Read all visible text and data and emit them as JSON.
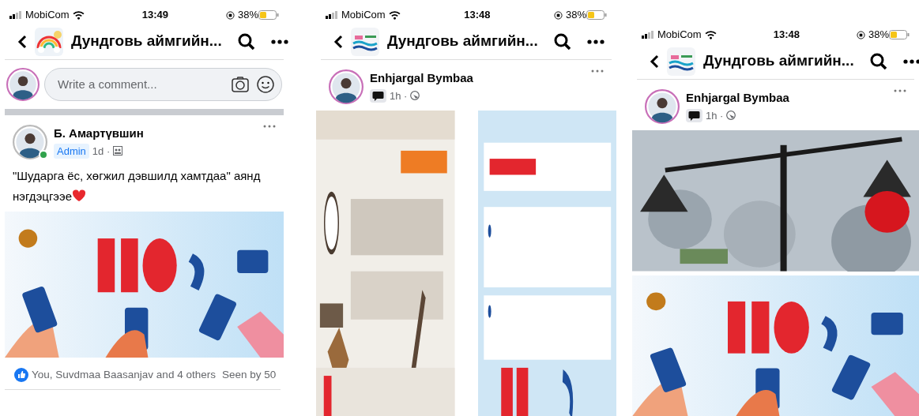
{
  "phones": [
    {
      "status_bar": {
        "carrier": "MobiCom",
        "time": "13:49",
        "battery": "38%"
      },
      "header": {
        "title": "Дундговь аймгийн..."
      },
      "composer": {
        "placeholder": "Write a comment..."
      },
      "post": {
        "author": "Б. Амартүвшин",
        "online": true,
        "role_badge": "Admin",
        "chat_badge": false,
        "time": "1d ·",
        "text": "\"Шударга ёс, хөгжил дэвшилд хамтдаа\" аянд нэгдэцгээе",
        "reactions": "You, Suvdmaa Baasanjav and 4 others",
        "seen": "Seen by 50"
      }
    },
    {
      "status_bar": {
        "carrier": "MobiCom",
        "time": "13:48",
        "battery": "38%"
      },
      "header": {
        "title": "Дундговь аймгийн..."
      },
      "post": {
        "author": "Enhjargal Bymbaa",
        "online": false,
        "chat_badge": true,
        "time": "1h ·"
      }
    },
    {
      "status_bar": {
        "carrier": "MobiCom",
        "time": "13:48",
        "battery": "38%"
      },
      "header": {
        "title": "Дундговь аймгийн..."
      },
      "post": {
        "author": "Enhjargal Bymbaa",
        "online": false,
        "chat_badge": true,
        "time": "1h ·"
      }
    }
  ]
}
